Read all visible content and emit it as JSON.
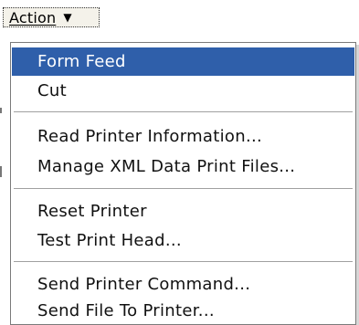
{
  "menubar": {
    "action_label": "Action",
    "arrow_glyph": "▼"
  },
  "menu": {
    "items": [
      {
        "label": "Form Feed"
      },
      {
        "label": "Cut"
      },
      {
        "label": "Read Printer Information..."
      },
      {
        "label": "Manage XML Data Print Files..."
      },
      {
        "label": "Reset Printer"
      },
      {
        "label": "Test Print Head..."
      },
      {
        "label": "Send Printer Command..."
      },
      {
        "label": "Send File To Printer..."
      }
    ],
    "selected_item": "Form Feed"
  },
  "colors": {
    "selection": "#2f5faa",
    "selection_text": "#ffffff",
    "menu_border": "#7a7a7a",
    "separator": "#a0a0a0"
  }
}
